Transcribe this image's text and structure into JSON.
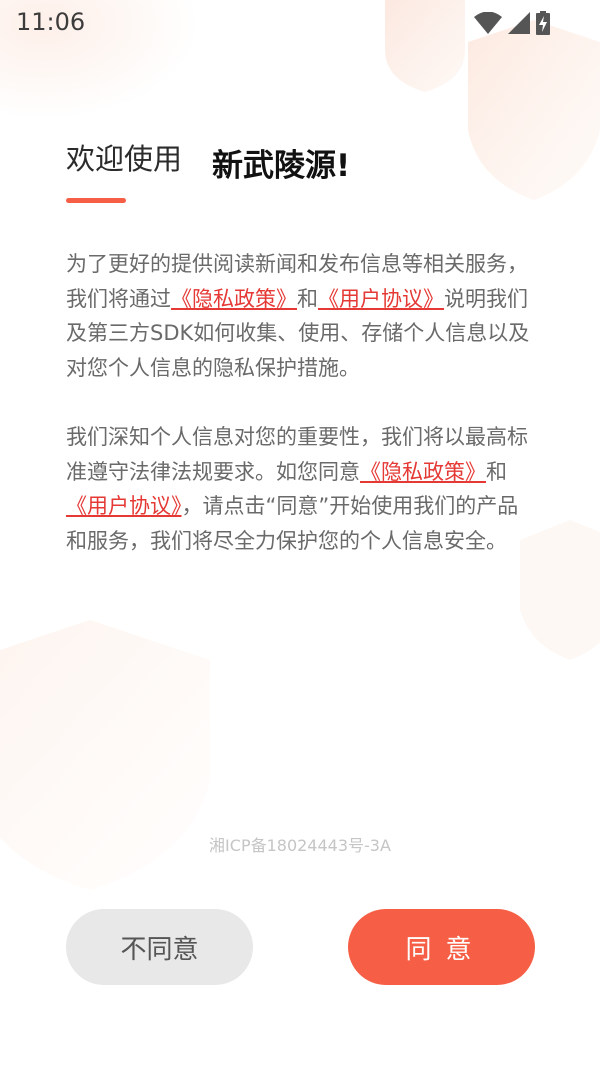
{
  "status_bar": {
    "time": "11:06"
  },
  "heading": {
    "welcome": "欢迎使用",
    "app_name": "新武陵源!"
  },
  "paragraph1": {
    "text1": "为了更好的提供阅读新闻和发布信息等相关服务，我们将通过",
    "link_privacy": "《隐私政策》",
    "and": "和",
    "link_agreement": "《用户协议》",
    "text2": "说明我们及第三方SDK如何收集、使用、存储个人信息以及对您个人信息的隐私保护措施。"
  },
  "paragraph2": {
    "text1": "我们深知个人信息对您的重要性，我们将以最高标准遵守法律法规要求。如您同意",
    "link_privacy": "《隐私政策》",
    "and": "和",
    "link_agreement": "《用户协议》",
    "text2": "，请点击“同意”开始使用我们的产品和服务，我们将尽全力保护您的个人信息安全。"
  },
  "footer": {
    "icp": "湘ICP备18024443号-3A"
  },
  "buttons": {
    "disagree": "不同意",
    "agree": "同意"
  },
  "colors": {
    "accent": "#f65f45",
    "link": "#e53935",
    "body_text": "#6a6a6a"
  },
  "icons": {
    "status": [
      "wifi-icon",
      "cellular-signal-icon",
      "battery-charging-icon"
    ]
  }
}
